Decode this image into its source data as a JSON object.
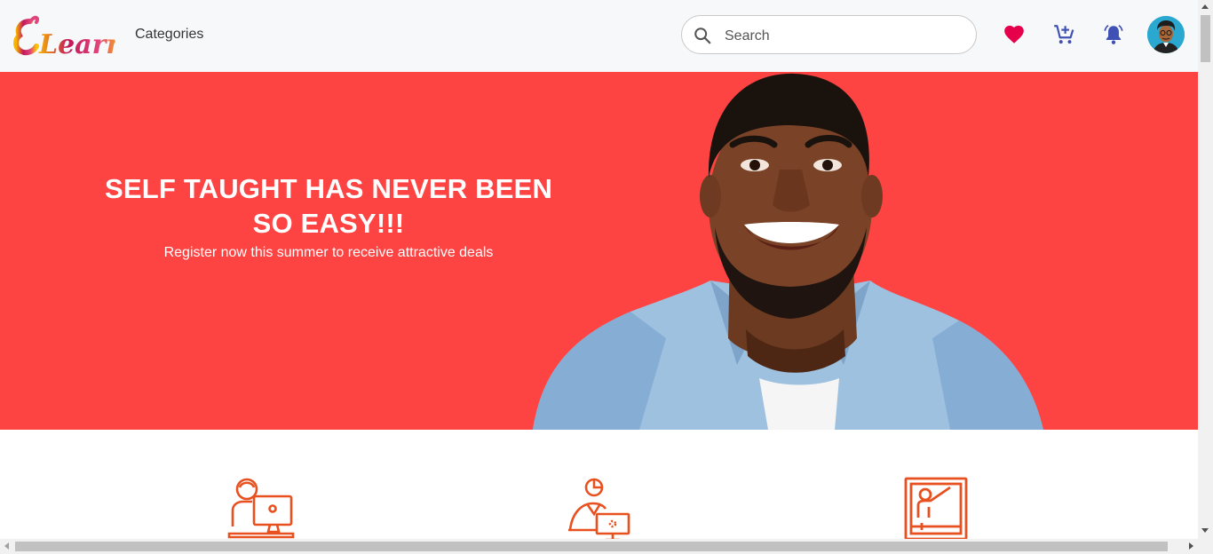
{
  "header": {
    "logo_text": "ELearn",
    "categories_label": "Categories",
    "search": {
      "placeholder": "Search",
      "value": ""
    },
    "icons": [
      "heart-icon",
      "cart-add-icon",
      "bell-icon",
      "avatar"
    ]
  },
  "hero": {
    "title": "SELF TAUGHT HAS NEVER BEEN SO EASY!!!",
    "subtitle": "Register now this summer to receive attractive deals",
    "background_color": "#fe4343"
  },
  "features": {
    "icons": [
      "student-computer-icon",
      "online-tutor-icon",
      "teacher-board-icon"
    ],
    "accent_color": "#e8501f"
  },
  "colors": {
    "heart": "#e6004c",
    "icon_blue": "#3f51b5"
  }
}
